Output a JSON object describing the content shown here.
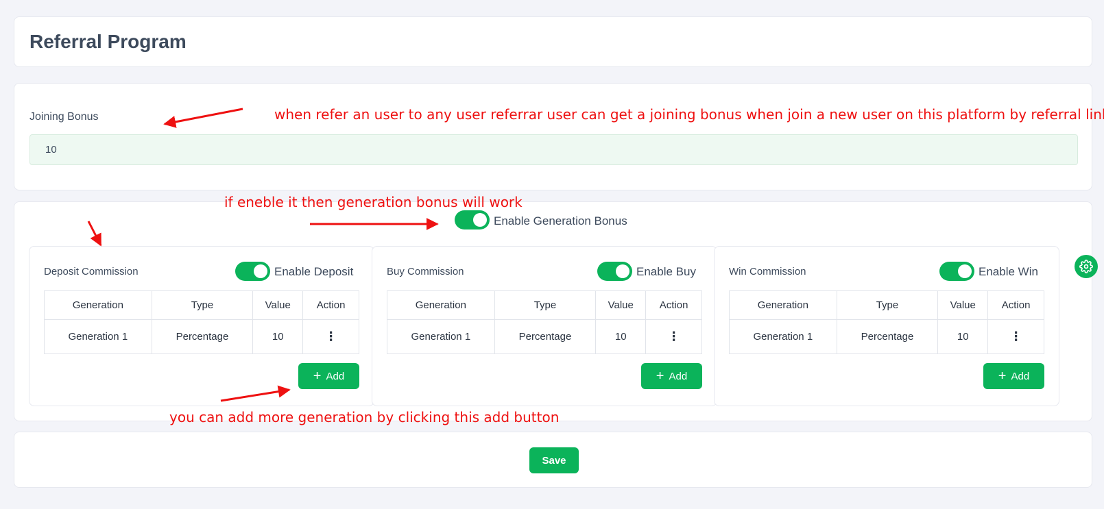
{
  "page": {
    "title": "Referral Program"
  },
  "joining": {
    "label": "Joining Bonus",
    "value": "10"
  },
  "generation": {
    "toggle_label": "Enable Generation Bonus",
    "enabled": true
  },
  "panels": [
    {
      "title": "Deposit Commission",
      "toggle_label": "Enable Deposit",
      "enabled": true,
      "headers": [
        "Generation",
        "Type",
        "Value",
        "Action"
      ],
      "rows": [
        {
          "generation": "Generation 1",
          "type": "Percentage",
          "value": "10",
          "action_icon": "kebab-menu-icon"
        }
      ],
      "add_label": "Add"
    },
    {
      "title": "Buy Commission",
      "toggle_label": "Enable Buy",
      "enabled": true,
      "headers": [
        "Generation",
        "Type",
        "Value",
        "Action"
      ],
      "rows": [
        {
          "generation": "Generation 1",
          "type": "Percentage",
          "value": "10",
          "action_icon": "kebab-menu-icon"
        }
      ],
      "add_label": "Add"
    },
    {
      "title": "Win Commission",
      "toggle_label": "Enable Win",
      "enabled": true,
      "headers": [
        "Generation",
        "Type",
        "Value",
        "Action"
      ],
      "rows": [
        {
          "generation": "Generation 1",
          "type": "Percentage",
          "value": "10",
          "action_icon": "kebab-menu-icon"
        }
      ],
      "add_label": "Add"
    }
  ],
  "save_label": "Save",
  "settings_icon": "gear-icon",
  "annotations": {
    "joining": "when refer an user to any user referrar user can get a joining bonus when join a new user on this platform by referral link",
    "enable": "if eneble it then generation bonus will work",
    "add": "you can add more generation by clicking this add button"
  },
  "colors": {
    "accent": "#0bb35a",
    "annotation": "#ee1111",
    "page_bg": "#f3f4f9",
    "input_bg": "#eef9f2"
  }
}
